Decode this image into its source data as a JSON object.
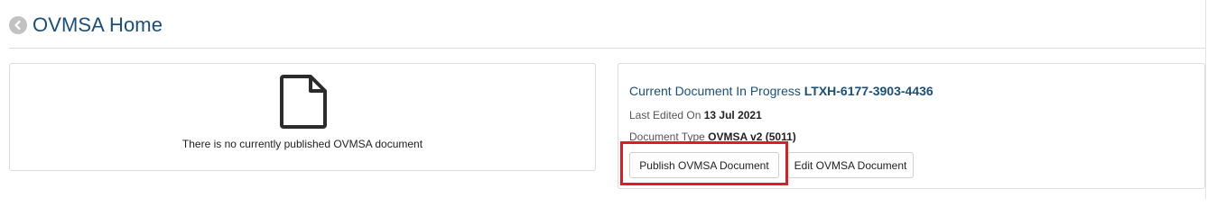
{
  "header": {
    "title": "OVMSA Home",
    "back_icon": "chevron-left-circle-icon"
  },
  "published_panel": {
    "icon": "document-icon",
    "empty_message": "There is no currently published OVMSA document"
  },
  "current_panel": {
    "label": "Current Document In Progress",
    "document_id": "LTXH-6177-3903-4436",
    "last_edited_label": "Last Edited On",
    "last_edited_value": "13 Jul 2021",
    "document_type_label": "Document Type",
    "document_type_value": "OVMSA v2 (5011)",
    "publish_button": "Publish OVMSA Document",
    "edit_button": "Edit OVMSA Document"
  },
  "colors": {
    "title": "#1b4f7a",
    "highlight": "#dd1c2a",
    "border": "#dcdcdc"
  }
}
